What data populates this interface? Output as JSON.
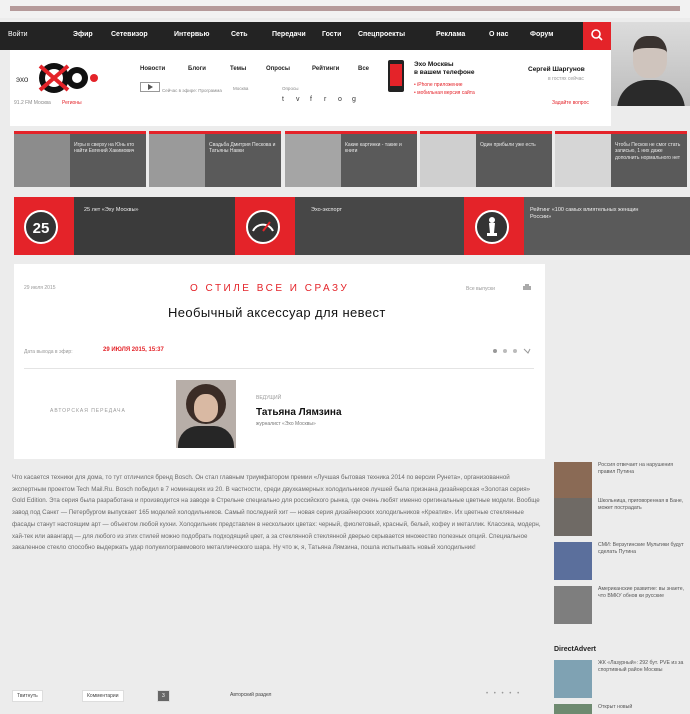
{
  "menu": {
    "left": "Войти",
    "items": [
      "Эфир",
      "Сетевизор",
      "Интервью",
      "Сеть",
      "Передачи",
      "Гости",
      "Спецпроекты",
      "Реклама",
      "О нас",
      "Форум"
    ]
  },
  "logo": {
    "caption": "91.2 FM Москва",
    "caption_link": "Регионы"
  },
  "subnav": [
    "Новости",
    "Блоги",
    "Темы",
    "Опросы",
    "Рейтинги",
    "Все"
  ],
  "header_small": {
    "program": "Сейчас в эфире: Программа",
    "weather": "Москва",
    "nav": "Опросы"
  },
  "social": [
    "t",
    "v",
    "f",
    "r",
    "o",
    "g"
  ],
  "promo": {
    "title_line1": "Эхо Москвы",
    "title_line2": "в вашем телефоне",
    "link1": "• iPhone приложение",
    "link2": "• мобильная версия сайта"
  },
  "person": {
    "name": "Сергей Шаргунов",
    "subtitle": "в гостях сейчас",
    "link": "Задайте вопрос"
  },
  "news_cards": [
    {
      "text": "Игры в сверху на Юнь кто найти Евгений Хакимович"
    },
    {
      "text": "Свадьба Дмитрия Пескова и Татьяны Навки"
    },
    {
      "text": "Какие картинки - такие и книги"
    },
    {
      "text": "Один прибыли уже есть"
    },
    {
      "text": "Чтобы Песков не смог стать записью, 1 них даже дополнить нормального нет"
    }
  ],
  "special": [
    {
      "badge": "25",
      "label": "25 лет «Эху Москвы»"
    },
    {
      "label": "Эхо-экспорт"
    },
    {
      "label": "Рейтинг «100 самых влиятельных женщин России»"
    }
  ],
  "article": {
    "date": "29 июля 2015",
    "section": "О СТИЛЕ ВСЕ И СРАЗУ",
    "right_meta": "Все выпуски",
    "title": "Необычный аксессуар для невест",
    "datetime_prefix": "Дата выхода в эфир:",
    "datetime": "29 ИЮЛЯ 2015, 15:37",
    "program_label": "АВТОРСКАЯ ПЕРЕДАЧА",
    "host_role": "ВЕДУЩИЙ",
    "host_name": "Татьяна Лямзина",
    "host_subtitle": "журналист «Эхо Москвы»"
  },
  "body_text": "Что касается техники для дома, то тут отличился бренд Bosch. Он стал главным триумфатором премии «Лучшая бытовая техника 2014 по версии Рунета», организованной экспертным проектом Tech Mail.Ru. Bosch победил в 7 номинациях из 20. В частности, среди двухкамерных холодильников лучшей была признана дизайнерская «Золотая серия» Gold Edition. Эта серия была разработана и производится на заводе в Стрельне специально для российского рынка, где очень любят именно оригинальные цветные модели. Вообще завод под Санкт — Петербургом выпускает 165 моделей холодильников. Самый последний хит — новая серия дизайнерских холодильников «Креатив». Их цветные стеклянные фасады станут настоящим арт — объектом любой кухни. Холодильник представлен в нескольких цветах: черный, фиолетовый, красный, белый, кофеу и металлик. Классика, модерн, хай-тек или авангард — для любого из этих стилей можно подобрать подходящий цвет, а за стеклянной стеклянной дверью скрывается множество полезных опций. Специальное закаленное стекло способно выдержать удар полукилограммового металлического шара. Ну что ж, я, Татьяна Лямзина, пошла испытывать новый холодильник!",
  "share": {
    "twitter": "Твитнуть",
    "vk": "Комментарии",
    "count": "3",
    "comments": "Авторский раздел"
  },
  "sidebar": {
    "items": [
      {
        "text": "Россия отвечает на нарушения правил Путина"
      },
      {
        "text": "Школьница, приговоренная в Бане, может пострадать"
      },
      {
        "text": "СМИ: Верзугинские Мультики будут сделать Путина"
      },
      {
        "text": "Американские развитие: вы знаете, что ВМКУ обнов ки русские"
      }
    ],
    "section_head": "DirectAdvert",
    "ads": [
      {
        "text": "ЖК «Лазурный»: 292 бут. PVE из за спортивный район Москвы"
      },
      {
        "text": "Открыт новый"
      }
    ]
  }
}
